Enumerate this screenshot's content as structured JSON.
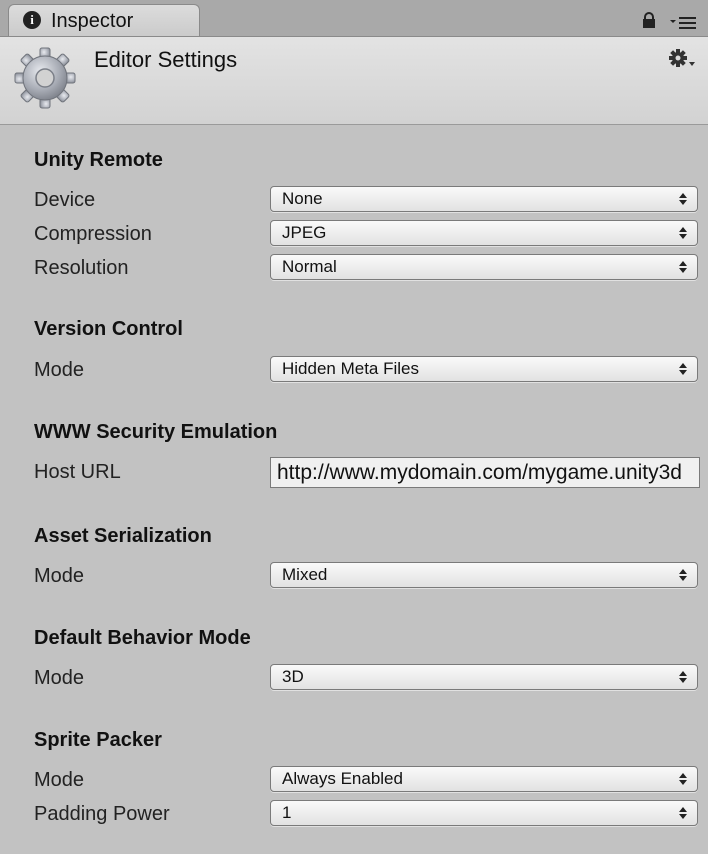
{
  "tab": {
    "label": "Inspector"
  },
  "header": {
    "title": "Editor Settings"
  },
  "unity_remote": {
    "heading": "Unity Remote",
    "device": {
      "label": "Device",
      "value": "None"
    },
    "compression": {
      "label": "Compression",
      "value": "JPEG"
    },
    "resolution": {
      "label": "Resolution",
      "value": "Normal"
    }
  },
  "version_control": {
    "heading": "Version Control",
    "mode": {
      "label": "Mode",
      "value": "Hidden Meta Files"
    }
  },
  "www_security": {
    "heading": "WWW Security Emulation",
    "host_url": {
      "label": "Host URL",
      "value": "http://www.mydomain.com/mygame.unity3d"
    }
  },
  "asset_serialization": {
    "heading": "Asset Serialization",
    "mode": {
      "label": "Mode",
      "value": "Mixed"
    }
  },
  "default_behavior": {
    "heading": "Default Behavior Mode",
    "mode": {
      "label": "Mode",
      "value": "3D"
    }
  },
  "sprite_packer": {
    "heading": "Sprite Packer",
    "mode": {
      "label": "Mode",
      "value": "Always Enabled"
    },
    "padding_power": {
      "label": "Padding Power",
      "value": "1"
    }
  },
  "icons": {
    "tab_icon": "info-icon",
    "lock": "lock-icon",
    "menu": "tab-menu-icon",
    "header_icon": "gear-icon",
    "settings": "settings-gear-icon",
    "dropdown_arrows": "up-down-arrows-icon"
  }
}
